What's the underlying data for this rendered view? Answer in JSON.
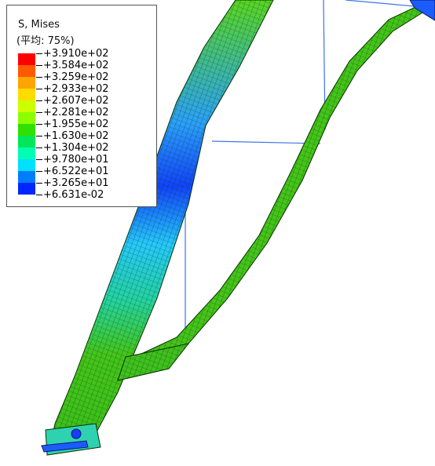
{
  "legend": {
    "title": "S, Mises",
    "subtitle": "(平均: 75%)",
    "values": [
      "+3.910e+02",
      "+3.584e+02",
      "+3.259e+02",
      "+2.933e+02",
      "+2.607e+02",
      "+2.281e+02",
      "+1.955e+02",
      "+1.630e+02",
      "+1.304e+02",
      "+9.780e+01",
      "+6.522e+01",
      "+3.265e+01",
      "+6.631e-02"
    ],
    "band_colors": [
      "#ff0000",
      "#ff5a00",
      "#ffa400",
      "#ffdc00",
      "#ceff00",
      "#8cff00",
      "#2fe000",
      "#00e85a",
      "#00ffb2",
      "#00e0ff",
      "#007dff",
      "#0026ff"
    ]
  },
  "model_colors": {
    "frame_green": "#44c41a",
    "frame_blue": "#1b5cff",
    "frame_teal": "#1ed8b0",
    "mesh_lines": "#0d3a00",
    "wire": "#3a74e8"
  }
}
